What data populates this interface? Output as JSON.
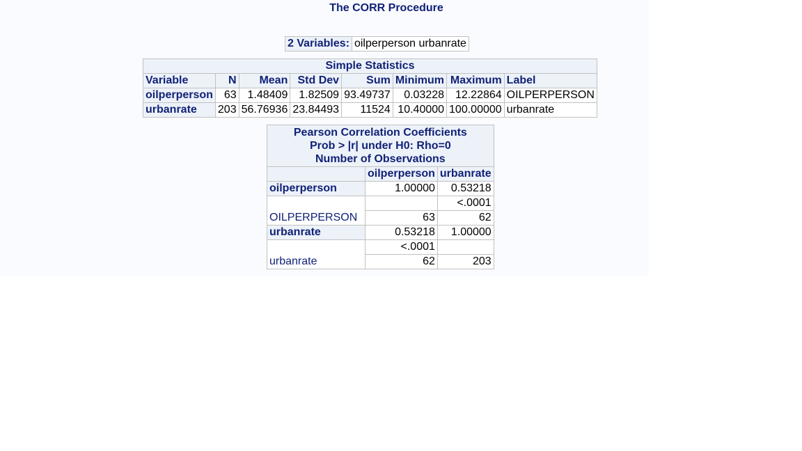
{
  "procedure_title": "The CORR Procedure",
  "variables_info": {
    "label": "2  Variables:",
    "value": "oilperperson urbanrate"
  },
  "simple_statistics": {
    "title": "Simple Statistics",
    "columns": [
      "Variable",
      "N",
      "Mean",
      "Std Dev",
      "Sum",
      "Minimum",
      "Maximum",
      "Label"
    ],
    "rows": [
      {
        "variable": "oilperperson",
        "n": "63",
        "mean": "1.48409",
        "std_dev": "1.82509",
        "sum": "93.49737",
        "minimum": "0.03228",
        "maximum": "12.22864",
        "label": "OILPERPERSON"
      },
      {
        "variable": "urbanrate",
        "n": "203",
        "mean": "56.76936",
        "std_dev": "23.84493",
        "sum": "11524",
        "minimum": "10.40000",
        "maximum": "100.00000",
        "label": "urbanrate"
      }
    ]
  },
  "correlation": {
    "title_lines": [
      "Pearson Correlation Coefficients",
      "Prob > |r| under H0: Rho=0",
      "Number of Observations"
    ],
    "columns": [
      "oilperperson",
      "urbanrate"
    ],
    "rows": [
      {
        "name": "oilperperson",
        "label": "OILPERPERSON",
        "coef": [
          "1.00000",
          "0.53218"
        ],
        "prob": [
          "",
          "<.0001"
        ],
        "nobs": [
          "63",
          "62"
        ]
      },
      {
        "name": "urbanrate",
        "label": "urbanrate",
        "coef": [
          "0.53218",
          "1.00000"
        ],
        "prob": [
          "<.0001",
          ""
        ],
        "nobs": [
          "62",
          "203"
        ]
      }
    ]
  },
  "colors": {
    "header_bg": "#edf2f9",
    "header_text": "#112277",
    "border": "#c1c1c1",
    "page_bg": "#fafbfe"
  }
}
